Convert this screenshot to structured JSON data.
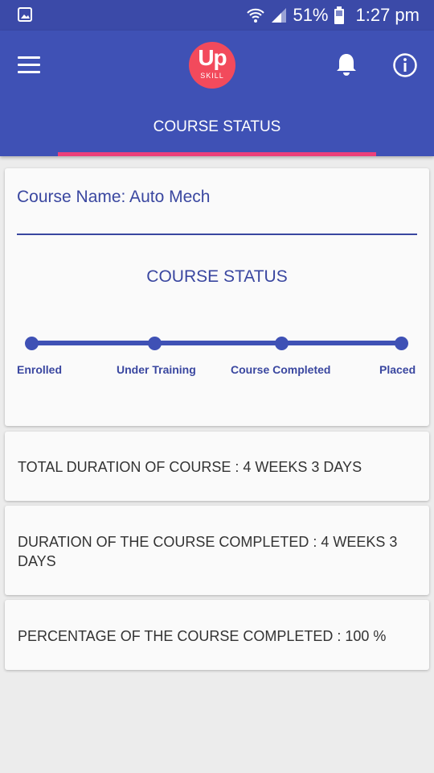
{
  "status_bar": {
    "battery": "51%",
    "time": "1:27 pm",
    "icons": [
      "gallery-icon",
      "wifi-icon",
      "signal-icon",
      "battery-icon"
    ]
  },
  "app_bar": {
    "logo_top": "Up",
    "logo_bottom": "SKILL",
    "tab_label": "COURSE STATUS",
    "icons": [
      "menu-icon",
      "bell-icon",
      "info-icon"
    ]
  },
  "course_card": {
    "course_name": "Course Name: Auto Mech",
    "status_title": "COURSE STATUS",
    "steps": [
      "Enrolled",
      "Under Training",
      "Course Completed",
      "Placed"
    ],
    "completed_steps": 4
  },
  "details": {
    "total_duration": "TOTAL DURATION OF COURSE : 4 WEEKS 3 DAYS",
    "completed_duration": "DURATION OF THE COURSE COMPLETED : 4 WEEKS 3 DAYS",
    "percentage": "PERCENTAGE OF THE COURSE COMPLETED : 100 %"
  },
  "colors": {
    "primary": "#3f51b5",
    "status_bar": "#3b4aa8",
    "accent": "#ec407a",
    "logo": "#f24a5c",
    "text_primary": "#3a47a0"
  }
}
